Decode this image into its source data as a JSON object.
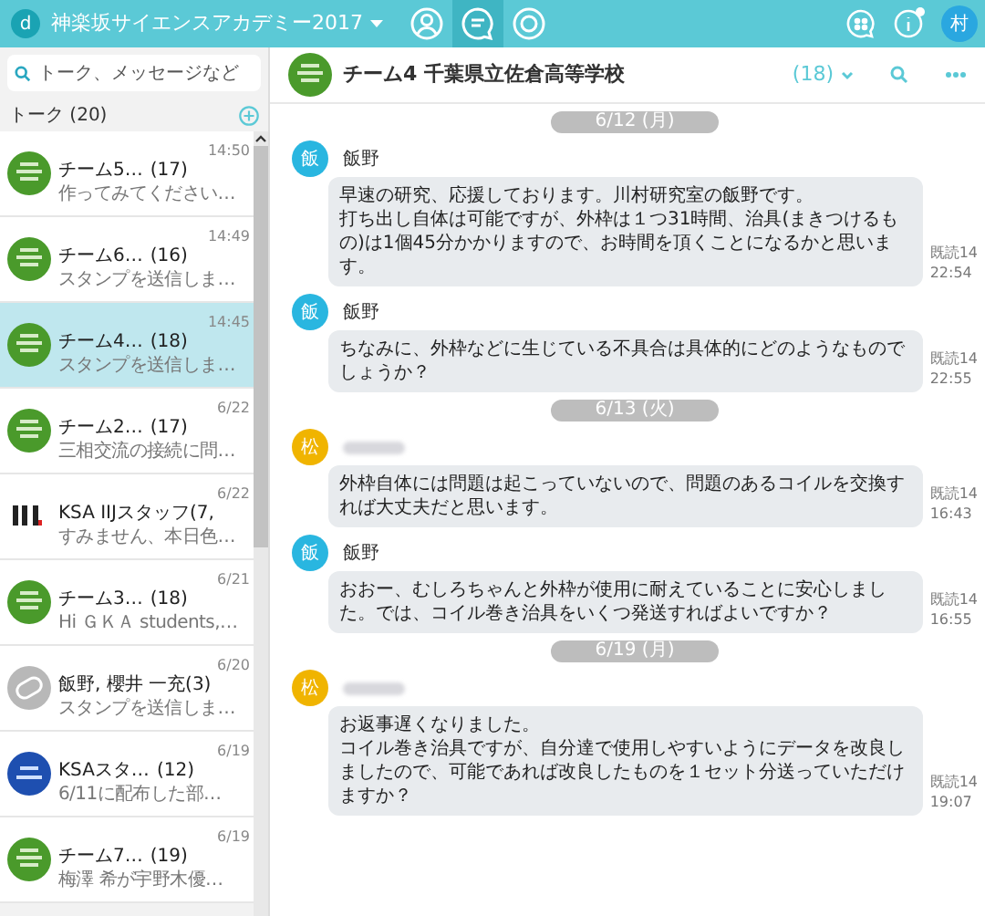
{
  "app_bar": {
    "logo": "d",
    "title": "神楽坂サイエンスアカデミー2017",
    "nav": [
      {
        "kind": "contacts",
        "selected": false
      },
      {
        "kind": "talk",
        "selected": true
      },
      {
        "kind": "target",
        "selected": false
      }
    ],
    "user_initial": "村",
    "info_unread": true
  },
  "sidebar": {
    "search": {
      "placeholder": "トーク、メッセージなど"
    },
    "heading": "トーク (20)",
    "talks": [
      {
        "kind": "team",
        "name": "チーム5…",
        "count": "(17)",
        "time": "14:50",
        "preview": "作ってみてください…",
        "selected": false
      },
      {
        "kind": "team",
        "name": "チーム6…",
        "count": "(16)",
        "time": "14:49",
        "preview": "スタンプを送信しま…",
        "selected": false
      },
      {
        "kind": "team",
        "name": "チーム4…",
        "count": "(18)",
        "time": "14:45",
        "preview": "スタンプを送信しま…",
        "selected": true
      },
      {
        "kind": "team",
        "name": "チーム2…",
        "count": "(17)",
        "time": "6/22",
        "preview": "三相交流の接続に問…",
        "selected": false
      },
      {
        "kind": "logo",
        "name": "KSA IIJスタッフ(7,",
        "time": "6/22",
        "preview": "すみません、本日色…",
        "selected": false
      },
      {
        "kind": "team",
        "name": "チーム3…",
        "count": "(18)",
        "time": "6/21",
        "preview": "Hi ＧＫＡ students,…",
        "selected": false
      },
      {
        "kind": "group",
        "name": "飯野, 櫻井 一充(3)",
        "time": "6/20",
        "preview": "スタンプを送信しま…",
        "selected": false
      },
      {
        "kind": "staff",
        "name": "KSAスタ…",
        "count": "(12)",
        "time": "6/19",
        "preview": "6/11に配布した部…",
        "selected": false
      },
      {
        "kind": "team",
        "name": "チーム7…",
        "count": "(19)",
        "time": "6/19",
        "preview": "梅澤 希が宇野木優…",
        "selected": false
      }
    ]
  },
  "chat": {
    "title": "チーム4 千葉県立佐倉高等学校",
    "members": "(18)",
    "timeline": [
      {
        "kind": "date",
        "label": "6/12 (月)"
      },
      {
        "kind": "message",
        "initial": "飯",
        "color": "#29b6e0",
        "sender": "飯野",
        "lines": [
          "早速の研究、応援しております。川村研究室の飯野です。",
          "打ち出し自体は可能ですが、外枠は１つ31時間、治具(まきつけるもの)は1個45分かかりますので、お時間を頂くことになるかと思います。"
        ],
        "read": "既読14",
        "time": "22:54"
      },
      {
        "kind": "message",
        "initial": "飯",
        "color": "#29b6e0",
        "sender": "飯野",
        "lines": [
          "ちなみに、外枠などに生じている不具合は具体的にどのようなものでしょうか？"
        ],
        "read": "既読14",
        "time": "22:55"
      },
      {
        "kind": "date",
        "label": "6/13 (火)"
      },
      {
        "kind": "message",
        "initial": "松",
        "color": "#f0b400",
        "lines": [
          "外枠自体には問題は起こっていないので、問題のあるコイルを交換すれば大丈夫だと思います。"
        ],
        "read": "既読14",
        "time": "16:43"
      },
      {
        "kind": "message",
        "initial": "飯",
        "color": "#29b6e0",
        "sender": "飯野",
        "lines": [
          "おおー、むしろちゃんと外枠が使用に耐えていることに安心しました。では、コイル巻き治具をいくつ発送すればよいですか？"
        ],
        "read": "既読14",
        "time": "16:55"
      },
      {
        "kind": "date",
        "label": "6/19 (月)"
      },
      {
        "kind": "message",
        "initial": "松",
        "color": "#f0b400",
        "lines": [
          "お返事遅くなりました。",
          "コイル巻き治具ですが、自分達で使用しやすいようにデータを改良しましたので、可能であれば改良したものを１セット分送っていただけますか？"
        ],
        "read": "既読14",
        "time": "19:07"
      }
    ]
  }
}
